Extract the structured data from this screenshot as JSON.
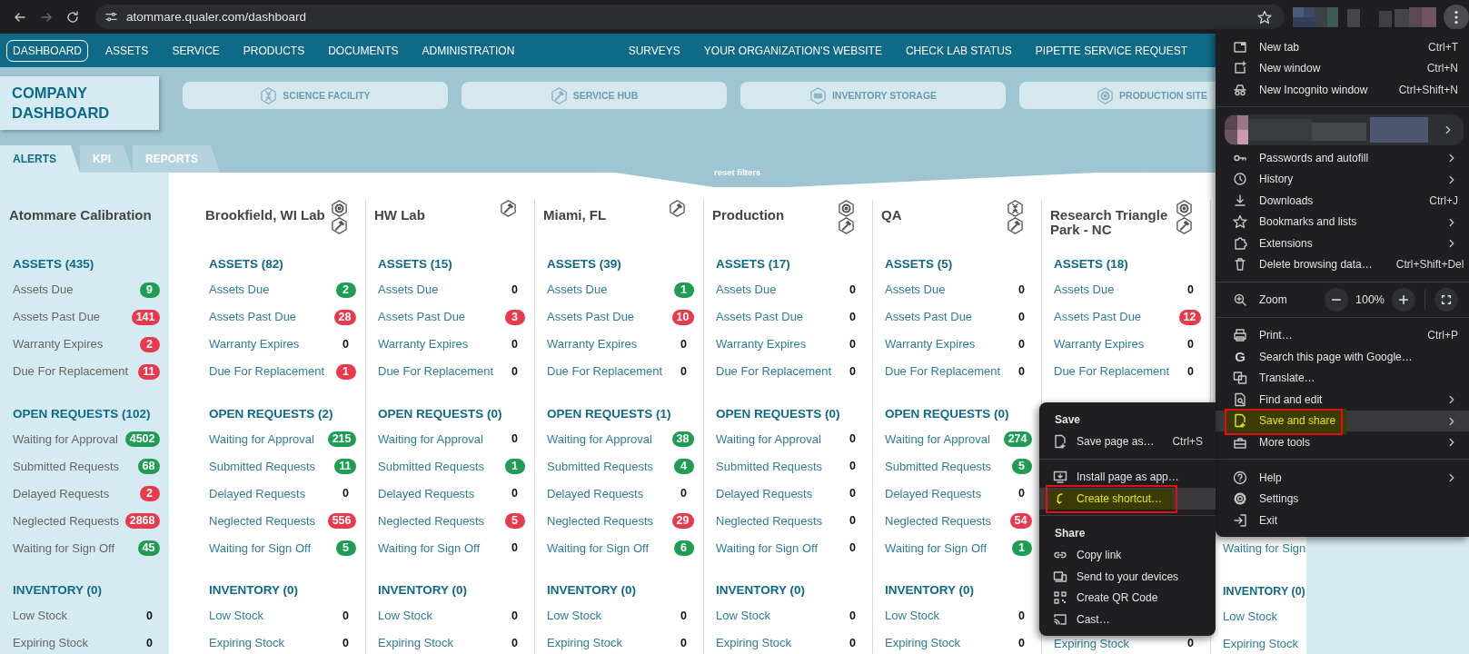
{
  "browser": {
    "url": "atommare.qualer.com/dashboard"
  },
  "nav": {
    "left_items": [
      {
        "label": "DASHBOARD",
        "selected": true
      },
      {
        "label": "ASSETS",
        "selected": false
      },
      {
        "label": "SERVICE",
        "selected": false
      },
      {
        "label": "PRODUCTS",
        "selected": false
      },
      {
        "label": "DOCUMENTS",
        "selected": false
      },
      {
        "label": "ADMINISTRATION",
        "selected": false
      }
    ],
    "right_items": [
      {
        "label": "SURVEYS",
        "selected": false
      },
      {
        "label": "YOUR ORGANIZATION'S WEBSITE",
        "selected": false
      },
      {
        "label": "CHECK LAB STATUS",
        "selected": false
      },
      {
        "label": "PIPETTE SERVICE REQUEST",
        "selected": false
      }
    ]
  },
  "page_title": "COMPANY DASHBOARD",
  "facilities": [
    {
      "label": "SCIENCE FACILITY",
      "kind": "dna"
    },
    {
      "label": "SERVICE HUB",
      "kind": "hammer"
    },
    {
      "label": "INVENTORY STORAGE",
      "kind": "box"
    },
    {
      "label": "PRODUCTION SITE",
      "kind": "gear"
    }
  ],
  "tabs": [
    {
      "label": "ALERTS",
      "selected": true
    },
    {
      "label": "KPI",
      "selected": false
    },
    {
      "label": "REPORTS",
      "selected": false
    }
  ],
  "reset_filters": "reset filters",
  "columns": [
    {
      "kind": "summary",
      "title": "Atommare Calibration",
      "sections": [
        {
          "kind": "section",
          "title": "ASSETS (435)",
          "items": [
            {
              "label": "Assets Due",
              "value": "9",
              "color": "#1f9d55"
            },
            {
              "label": "Assets Past Due",
              "value": "141",
              "color": "#e8394d"
            },
            {
              "label": "Warranty Expires",
              "value": "2",
              "color": "#e8394d"
            },
            {
              "label": "Due For Replacement",
              "value": "11",
              "color": "#e8394d"
            }
          ]
        },
        {
          "kind": "section",
          "title": "OPEN REQUESTS (102)",
          "items": [
            {
              "label": "Waiting for Approval",
              "value": "4502",
              "color": "#1f9d55"
            },
            {
              "label": "Submitted Requests",
              "value": "68",
              "color": "#1f9d55"
            },
            {
              "label": "Delayed Requests",
              "value": "2",
              "color": "#e8394d"
            },
            {
              "label": "Neglected Requests",
              "value": "2868",
              "color": "#e8394d"
            },
            {
              "label": "Waiting for Sign Off",
              "value": "45",
              "color": "#1f9d55"
            }
          ]
        },
        {
          "kind": "section",
          "title": "INVENTORY (0)",
          "items": [
            {
              "label": "Low Stock",
              "value": "0"
            },
            {
              "label": "Expiring Stock",
              "value": "0"
            }
          ]
        }
      ]
    },
    {
      "kind": "site",
      "title": "Brookfield, WI Lab",
      "icons": [
        {
          "kind": "gear"
        },
        {
          "kind": "hammer"
        }
      ],
      "sections": [
        {
          "kind": "section",
          "title": "ASSETS (82)",
          "items": [
            {
              "label": "Assets Due",
              "value": "2",
              "color": "#1f9d55"
            },
            {
              "label": "Assets Past Due",
              "value": "28",
              "color": "#e8394d"
            },
            {
              "label": "Warranty Expires",
              "value": "0"
            },
            {
              "label": "Due For Replacement",
              "value": "1",
              "color": "#e8394d"
            }
          ]
        },
        {
          "kind": "section",
          "title": "OPEN REQUESTS (2)",
          "items": [
            {
              "label": "Waiting for Approval",
              "value": "215",
              "color": "#1f9d55"
            },
            {
              "label": "Submitted Requests",
              "value": "11",
              "color": "#1f9d55"
            },
            {
              "label": "Delayed Requests",
              "value": "0"
            },
            {
              "label": "Neglected Requests",
              "value": "556",
              "color": "#e8394d"
            },
            {
              "label": "Waiting for Sign Off",
              "value": "5",
              "color": "#1f9d55"
            }
          ]
        },
        {
          "kind": "section",
          "title": "INVENTORY (0)",
          "items": [
            {
              "label": "Low Stock",
              "value": "0"
            },
            {
              "label": "Expiring Stock",
              "value": "0"
            }
          ]
        }
      ]
    },
    {
      "kind": "site",
      "title": "HW Lab",
      "icons": [
        {
          "kind": "hammer"
        }
      ],
      "sections": [
        {
          "kind": "section",
          "title": "ASSETS (15)",
          "items": [
            {
              "label": "Assets Due",
              "value": "0"
            },
            {
              "label": "Assets Past Due",
              "value": "3",
              "color": "#e8394d"
            },
            {
              "label": "Warranty Expires",
              "value": "0"
            },
            {
              "label": "Due For Replacement",
              "value": "0"
            }
          ]
        },
        {
          "kind": "section",
          "title": "OPEN REQUESTS (0)",
          "items": [
            {
              "label": "Waiting for Approval",
              "value": "0"
            },
            {
              "label": "Submitted Requests",
              "value": "1",
              "color": "#1f9d55"
            },
            {
              "label": "Delayed Requests",
              "value": "0"
            },
            {
              "label": "Neglected Requests",
              "value": "5",
              "color": "#e8394d"
            },
            {
              "label": "Waiting for Sign Off",
              "value": "0"
            }
          ]
        },
        {
          "kind": "section",
          "title": "INVENTORY (0)",
          "items": [
            {
              "label": "Low Stock",
              "value": "0"
            },
            {
              "label": "Expiring Stock",
              "value": "0"
            }
          ]
        }
      ]
    },
    {
      "kind": "site",
      "title": "Miami, FL",
      "icons": [
        {
          "kind": "hammer"
        }
      ],
      "sections": [
        {
          "kind": "section",
          "title": "ASSETS (39)",
          "items": [
            {
              "label": "Assets Due",
              "value": "1",
              "color": "#1f9d55"
            },
            {
              "label": "Assets Past Due",
              "value": "10",
              "color": "#e8394d"
            },
            {
              "label": "Warranty Expires",
              "value": "0"
            },
            {
              "label": "Due For Replacement",
              "value": "0"
            }
          ]
        },
        {
          "kind": "section",
          "title": "OPEN REQUESTS (1)",
          "items": [
            {
              "label": "Waiting for Approval",
              "value": "38",
              "color": "#1f9d55"
            },
            {
              "label": "Submitted Requests",
              "value": "4",
              "color": "#1f9d55"
            },
            {
              "label": "Delayed Requests",
              "value": "0"
            },
            {
              "label": "Neglected Requests",
              "value": "29",
              "color": "#e8394d"
            },
            {
              "label": "Waiting for Sign Off",
              "value": "6",
              "color": "#1f9d55"
            }
          ]
        },
        {
          "kind": "section",
          "title": "INVENTORY (0)",
          "items": [
            {
              "label": "Low Stock",
              "value": "0"
            },
            {
              "label": "Expiring Stock",
              "value": "0"
            }
          ]
        }
      ]
    },
    {
      "kind": "site",
      "title": "Production",
      "icons": [
        {
          "kind": "gear"
        },
        {
          "kind": "hammer"
        }
      ],
      "sections": [
        {
          "kind": "section",
          "title": "ASSETS (17)",
          "items": [
            {
              "label": "Assets Due",
              "value": "0"
            },
            {
              "label": "Assets Past Due",
              "value": "0"
            },
            {
              "label": "Warranty Expires",
              "value": "0"
            },
            {
              "label": "Due For Replacement",
              "value": "0"
            }
          ]
        },
        {
          "kind": "section",
          "title": "OPEN REQUESTS (0)",
          "items": [
            {
              "label": "Waiting for Approval",
              "value": "0"
            },
            {
              "label": "Submitted Requests",
              "value": "0"
            },
            {
              "label": "Delayed Requests",
              "value": "0"
            },
            {
              "label": "Neglected Requests",
              "value": "0"
            },
            {
              "label": "Waiting for Sign Off",
              "value": "0"
            }
          ]
        },
        {
          "kind": "section",
          "title": "INVENTORY (0)",
          "items": [
            {
              "label": "Low Stock",
              "value": "0"
            },
            {
              "label": "Expiring Stock",
              "value": "0"
            }
          ]
        }
      ]
    },
    {
      "kind": "site",
      "title": "QA",
      "icons": [
        {
          "kind": "dna"
        },
        {
          "kind": "hammer"
        }
      ],
      "sections": [
        {
          "kind": "section",
          "title": "ASSETS (5)",
          "items": [
            {
              "label": "Assets Due",
              "value": "0"
            },
            {
              "label": "Assets Past Due",
              "value": "0"
            },
            {
              "label": "Warranty Expires",
              "value": "0"
            },
            {
              "label": "Due For Replacement",
              "value": "0"
            }
          ]
        },
        {
          "kind": "section",
          "title": "OPEN REQUESTS (0)",
          "items": [
            {
              "label": "Waiting for Approval",
              "value": "274",
              "color": "#1f9d55"
            },
            {
              "label": "Submitted Requests",
              "value": "5",
              "color": "#1f9d55"
            },
            {
              "label": "Delayed Requests",
              "value": "0"
            },
            {
              "label": "Neglected Requests",
              "value": "54",
              "color": "#e8394d"
            },
            {
              "label": "Waiting for Sign Off",
              "value": "1",
              "color": "#1f9d55"
            }
          ]
        },
        {
          "kind": "section",
          "title": "INVENTORY (0)",
          "items": [
            {
              "label": "Low Stock",
              "value": "0"
            },
            {
              "label": "Expiring Stock",
              "value": "0"
            }
          ]
        }
      ]
    },
    {
      "kind": "site",
      "title": "Research Triangle Park - NC",
      "icons": [
        {
          "kind": "gear"
        },
        {
          "kind": "hammer"
        }
      ],
      "sections": [
        {
          "kind": "section",
          "title": "ASSETS (18)",
          "items": [
            {
              "label": "Assets Due",
              "value": "0"
            },
            {
              "label": "Assets Past Due",
              "value": "12",
              "color": "#e8394d"
            },
            {
              "label": "Warranty Expires",
              "value": "0"
            },
            {
              "label": "Due For Replacement",
              "value": "0"
            }
          ]
        },
        {
          "kind": "tail",
          "items": [
            {
              "label": "Expiring Stock",
              "value": "0"
            }
          ]
        }
      ]
    },
    {
      "kind": "partial",
      "sections": [
        {
          "kind": "tail",
          "items": [
            {
              "label": "Waiting for Sign"
            }
          ]
        },
        {
          "kind": "section",
          "title": "INVENTORY (0)",
          "items": [
            {
              "label": "Low Stock"
            },
            {
              "label": "Expiring Stock"
            }
          ]
        }
      ]
    }
  ],
  "browser_menu": {
    "items": [
      {
        "kind": "item",
        "label": "New tab",
        "shortcut": "Ctrl+T",
        "submenu": false,
        "selected": false,
        "annotated": false
      },
      {
        "kind": "item",
        "label": "New window",
        "shortcut": "Ctrl+N",
        "submenu": false,
        "selected": false,
        "annotated": false
      },
      {
        "kind": "item",
        "label": "New Incognito window",
        "shortcut": "Ctrl+Shift+N",
        "submenu": false,
        "selected": false,
        "annotated": false
      },
      {
        "kind": "separator"
      },
      {
        "kind": "profile"
      },
      {
        "kind": "item",
        "label": "Passwords and autofill",
        "submenu": true,
        "selected": false,
        "annotated": false
      },
      {
        "kind": "item",
        "label": "History",
        "submenu": true,
        "selected": false,
        "annotated": false
      },
      {
        "kind": "item",
        "label": "Downloads",
        "shortcut": "Ctrl+J",
        "submenu": false,
        "selected": false,
        "annotated": false
      },
      {
        "kind": "item",
        "label": "Bookmarks and lists",
        "submenu": true,
        "selected": false,
        "annotated": false
      },
      {
        "kind": "item",
        "label": "Extensions",
        "submenu": true,
        "selected": false,
        "annotated": false
      },
      {
        "kind": "item",
        "label": "Delete browsing data…",
        "shortcut": "Ctrl+Shift+Del",
        "submenu": false,
        "selected": false,
        "annotated": false
      },
      {
        "kind": "separator"
      },
      {
        "kind": "zoom",
        "label": "Zoom",
        "value": "100%",
        "submenu": false,
        "selected": false,
        "annotated": false
      },
      {
        "kind": "separator"
      },
      {
        "kind": "item",
        "label": "Print…",
        "shortcut": "Ctrl+P",
        "submenu": false,
        "selected": false,
        "annotated": false
      },
      {
        "kind": "item",
        "label": "Search this page with Google…",
        "glyph": "G",
        "submenu": false,
        "selected": false,
        "annotated": false
      },
      {
        "kind": "item",
        "label": "Translate…",
        "submenu": false,
        "selected": false,
        "annotated": false
      },
      {
        "kind": "item",
        "label": "Find and edit",
        "submenu": true,
        "selected": false,
        "annotated": false
      },
      {
        "kind": "item",
        "label": "Save and share",
        "submenu": true,
        "selected": true,
        "annotated": true
      },
      {
        "kind": "item",
        "label": "More tools",
        "submenu": true,
        "selected": false,
        "annotated": false
      },
      {
        "kind": "separator"
      },
      {
        "kind": "item",
        "label": "Help",
        "submenu": true,
        "selected": false,
        "annotated": false
      },
      {
        "kind": "item",
        "label": "Settings",
        "submenu": false,
        "selected": false,
        "annotated": false
      },
      {
        "kind": "item",
        "label": "Exit",
        "submenu": false,
        "selected": false,
        "annotated": false
      }
    ]
  },
  "save_share_menu": {
    "items": [
      {
        "kind": "heading",
        "label": "Save"
      },
      {
        "kind": "item",
        "label": "Save page as…",
        "shortcut": "Ctrl+S",
        "selected": false,
        "annotated": false
      },
      {
        "kind": "separator"
      },
      {
        "kind": "item",
        "label": "Install page as app…",
        "selected": false,
        "annotated": false
      },
      {
        "kind": "item",
        "label": "Create shortcut…",
        "selected": true,
        "annotated": true
      },
      {
        "kind": "separator"
      },
      {
        "kind": "heading",
        "label": "Share"
      },
      {
        "kind": "item",
        "label": "Copy link",
        "selected": false,
        "annotated": false
      },
      {
        "kind": "item",
        "label": "Send to your devices",
        "selected": false,
        "annotated": false
      },
      {
        "kind": "item",
        "label": "Create QR Code",
        "selected": false,
        "annotated": false
      },
      {
        "kind": "item",
        "label": "Cast…",
        "selected": false,
        "annotated": false
      }
    ]
  }
}
